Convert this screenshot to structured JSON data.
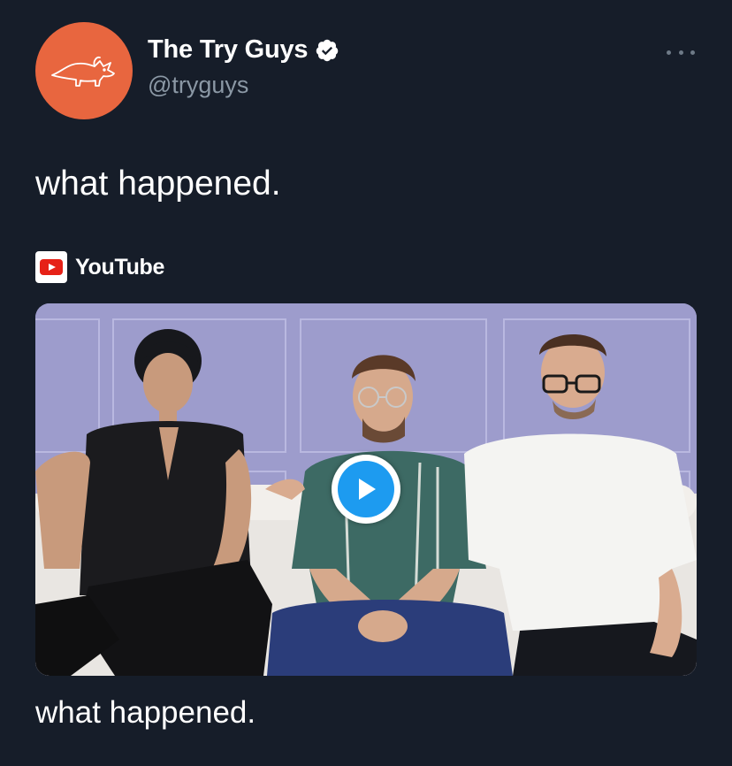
{
  "author": {
    "display_name": "The Try Guys",
    "handle": "@tryguys",
    "verified": true,
    "avatar_color": "#e8663f",
    "avatar_icon": "triceratops-icon"
  },
  "tweet": {
    "text": "what happened."
  },
  "card": {
    "source_name": "YouTube",
    "source_icon": "youtube-icon",
    "title": "what happened.",
    "play_icon": "play-icon"
  },
  "colors": {
    "background": "#161d29",
    "text": "#ffffff",
    "secondary_text": "#8b98a5",
    "accent": "#1d9bf0"
  }
}
